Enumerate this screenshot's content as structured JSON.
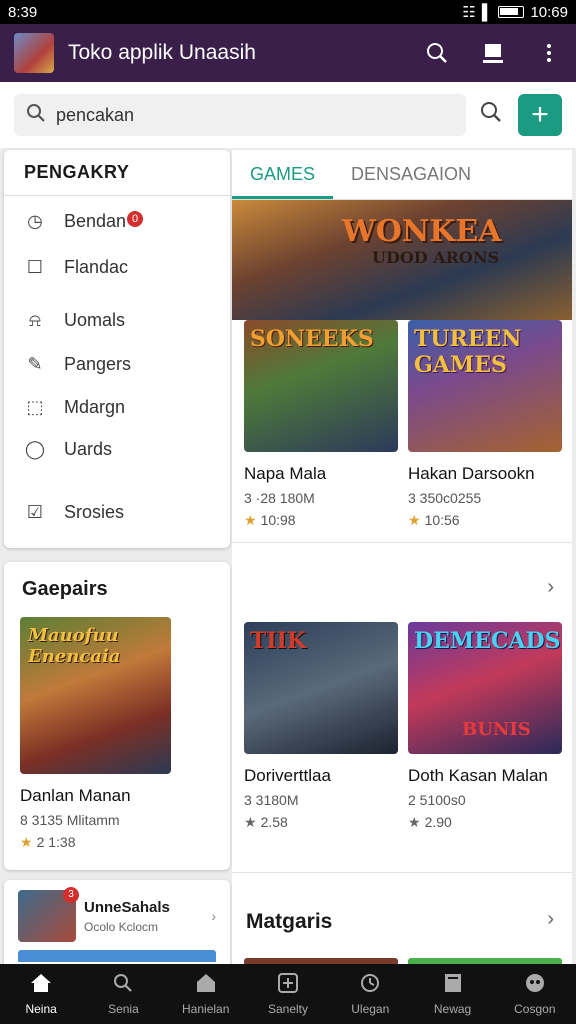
{
  "status": {
    "time": "8:39",
    "right_time": "10:69"
  },
  "appbar": {
    "title": "Toko applik Unaasih"
  },
  "search": {
    "value": "pencakan"
  },
  "sidebar": {
    "header": "PENGAKRY",
    "items": [
      {
        "label": "Bendan",
        "icon": "clock-icon",
        "badge": "0"
      },
      {
        "label": "Flandac",
        "icon": "bookmark-icon"
      },
      {
        "label": "Uomals",
        "icon": "bell-icon"
      },
      {
        "label": "Pangers",
        "icon": "pen-icon"
      },
      {
        "label": "Mdargn",
        "icon": "puzzle-icon"
      },
      {
        "label": "Uards",
        "icon": "search-icon"
      },
      {
        "label": "Srosies",
        "icon": "check-icon"
      }
    ]
  },
  "left_card": {
    "title": "Gaepairs",
    "game": {
      "title": "Danlan Manan",
      "sub": "8 3135 Mlitamm",
      "rating": "2 1:38",
      "thumb_text": "Mauofuu Enencaia"
    }
  },
  "bottom_card": {
    "title": "UnneSahals",
    "sub": "Ocolo Kclocm",
    "badge": "3"
  },
  "tabs": [
    "GAMES",
    "DENSAGAION"
  ],
  "banner": {
    "title": "WONKEA",
    "subtitle": "UDOD ARONS"
  },
  "games_row1": [
    {
      "thumb_text": "SONEEKS",
      "title": "Napa Mala",
      "sub": "3 ·28 180M",
      "rating": "10:98"
    },
    {
      "thumb_text": "TUREEN GAMES",
      "title": "Hakan Darsookn",
      "sub": "3 350c0255",
      "rating": "10:56"
    }
  ],
  "games_row2": [
    {
      "thumb_text": "TIIK",
      "title": "Doriverttlaa",
      "sub": "3 3180M",
      "rating": "2.58"
    },
    {
      "thumb_text": "DEMECADS",
      "thumb_text2": "BUNIS",
      "title": "Doth Kasan Malan",
      "sub": "2 5100s0",
      "rating": "2.90"
    }
  ],
  "section2": {
    "title": "Matgaris"
  },
  "nav": [
    {
      "label": "Neina",
      "icon": "home-icon"
    },
    {
      "label": "Senia",
      "icon": "search-icon"
    },
    {
      "label": "Hanielan",
      "icon": "house-icon"
    },
    {
      "label": "Sanelty",
      "icon": "plus-box-icon"
    },
    {
      "label": "Ulegan",
      "icon": "clock-icon"
    },
    {
      "label": "Newag",
      "icon": "news-icon"
    },
    {
      "label": "Cosgon",
      "icon": "controller-icon"
    }
  ]
}
